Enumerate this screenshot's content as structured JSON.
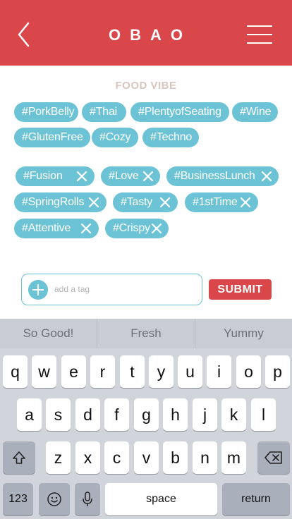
{
  "header": {
    "title": "OBAO"
  },
  "section": {
    "title": "FOOD VIBE"
  },
  "suggested_tags": [
    "#PorkBelly",
    "#Thai",
    "#PlentyofSeating",
    "#Wine",
    "#GlutenFree",
    "#Cozy",
    "#Techno"
  ],
  "selected_tags": [
    "#Fusion",
    "#Love",
    "#BusinessLunch",
    "#SpringRolls",
    "#Tasty",
    "#1stTime",
    "#Attentive",
    "#Crispy"
  ],
  "add_tag": {
    "placeholder": "add a tag",
    "submit_label": "SUBMIT"
  },
  "colors": {
    "brand": "#d9474b",
    "tag": "#6cc3d6",
    "section_title": "#d8c5bd"
  },
  "keyboard": {
    "suggestions": [
      "So Good!",
      "Fresh",
      "Yummy"
    ],
    "row1": [
      "q",
      "w",
      "e",
      "r",
      "t",
      "y",
      "u",
      "i",
      "o",
      "p"
    ],
    "row2": [
      "a",
      "s",
      "d",
      "f",
      "g",
      "h",
      "j",
      "k",
      "l"
    ],
    "row3": [
      "z",
      "x",
      "c",
      "v",
      "b",
      "n",
      "m"
    ],
    "numbers_label": "123",
    "space_label": "space",
    "return_label": "return"
  }
}
